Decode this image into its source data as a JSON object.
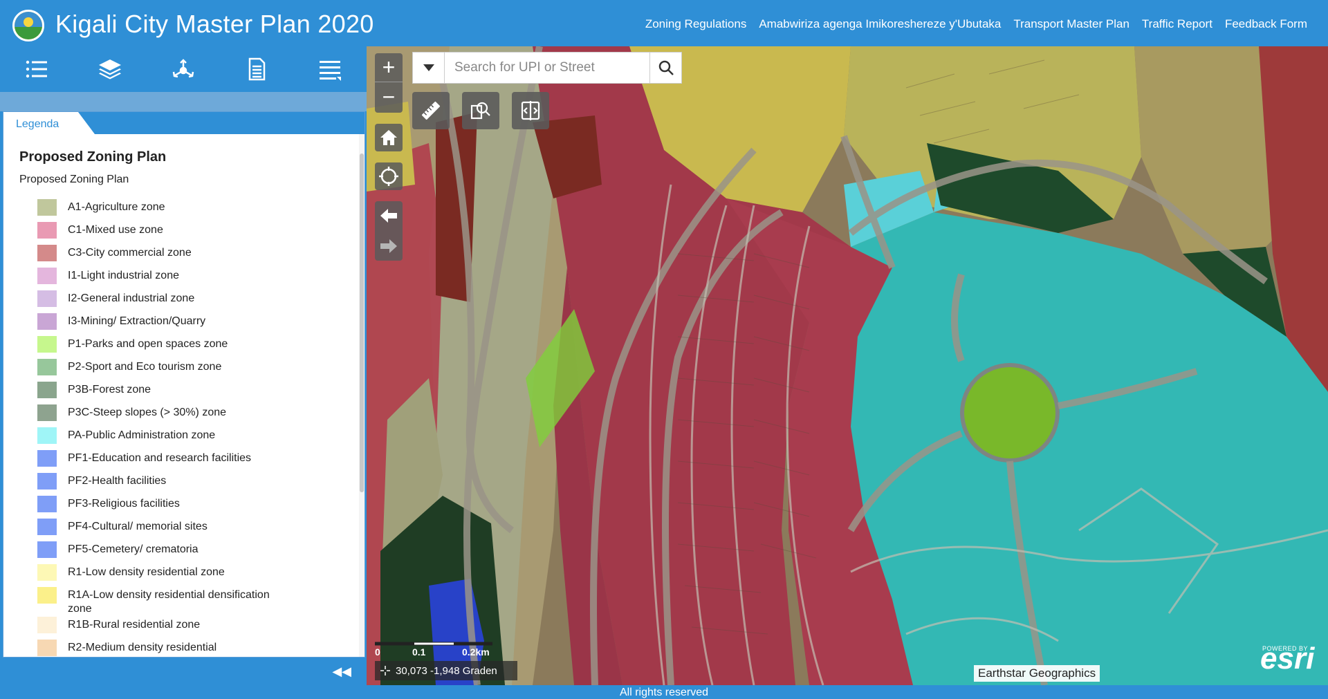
{
  "header": {
    "title": "Kigali City Master Plan 2020",
    "links": [
      "Zoning Regulations",
      "Amabwiriza agenga Imikoreshereze y'Ubutaka",
      "Transport Master Plan",
      "Traffic Report",
      "Feedback Form"
    ]
  },
  "toolbar": {
    "icons": [
      "list-icon",
      "layers-icon",
      "share-icon",
      "document-icon",
      "menu-icon"
    ]
  },
  "panel": {
    "tab_label": "Legenda",
    "legend_title": "Proposed Zoning Plan",
    "legend_subtitle": "Proposed Zoning Plan",
    "items": [
      {
        "label": "A1-Agriculture zone",
        "color": "#c0c79c"
      },
      {
        "label": "C1-Mixed use zone",
        "color": "#e99ab3"
      },
      {
        "label": "C3-City commercial zone",
        "color": "#d48a8a"
      },
      {
        "label": "I1-Light industrial zone",
        "color": "#e4b6dd"
      },
      {
        "label": "I2-General industrial zone",
        "color": "#d5bde4"
      },
      {
        "label": "I3-Mining/ Extraction/Quarry",
        "color": "#c9a6d5"
      },
      {
        "label": "P1-Parks and open spaces zone",
        "color": "#c6f78d"
      },
      {
        "label": "P2-Sport and Eco tourism zone",
        "color": "#97c79b"
      },
      {
        "label": "P3B-Forest zone",
        "color": "#8aa58d"
      },
      {
        "label": "P3C-Steep slopes (> 30%) zone",
        "color": "#8ea38f"
      },
      {
        "label": "PA-Public Administration zone",
        "color": "#9ff5f7"
      },
      {
        "label": "PF1-Education and research facilities",
        "color": "#7f9ef7"
      },
      {
        "label": "PF2-Health facilities",
        "color": "#7f9ef7"
      },
      {
        "label": "PF3-Religious facilities",
        "color": "#7f9ef7"
      },
      {
        "label": "PF4-Cultural/ memorial sites",
        "color": "#7f9ef7"
      },
      {
        "label": "PF5-Cemetery/ crematoria",
        "color": "#7f9ef7"
      },
      {
        "label": "R1-Low density residential zone",
        "color": "#fdf8b5"
      },
      {
        "label": "R1A-Low density residential densification zone",
        "color": "#fbf08a"
      },
      {
        "label": "R1B-Rural residential zone",
        "color": "#fdf1d9"
      },
      {
        "label": "R2-Medium density residential",
        "color": "#f7d8b3"
      }
    ]
  },
  "map": {
    "search_placeholder": "Search for UPI or Street",
    "scale_labels": [
      "0",
      "0.1",
      "0.2km"
    ],
    "coordinates": "30,073 -1,948 Graden",
    "attribution": "Earthstar Geographics",
    "logo_text": "esri",
    "powered_text": "POWERED BY"
  },
  "footer": {
    "text": "All rights reserved"
  }
}
